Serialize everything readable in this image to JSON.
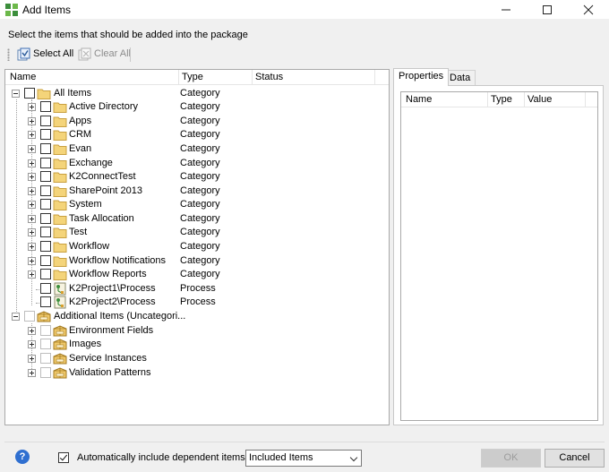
{
  "window": {
    "title": "Add Items",
    "minimize": "—",
    "maximize": "☐",
    "close": "✕"
  },
  "instruction": "Select the items that should be added into the package",
  "toolbar": {
    "select_all": "Select All",
    "clear_all": "Clear All"
  },
  "tree": {
    "columns": {
      "name": "Name",
      "type": "Type",
      "status": "Status"
    },
    "rows": [
      {
        "name": "All Items",
        "type": "Category"
      },
      {
        "name": "Active Directory",
        "type": "Category"
      },
      {
        "name": "Apps",
        "type": "Category"
      },
      {
        "name": "CRM",
        "type": "Category"
      },
      {
        "name": "Evan",
        "type": "Category"
      },
      {
        "name": "Exchange",
        "type": "Category"
      },
      {
        "name": "K2ConnectTest",
        "type": "Category"
      },
      {
        "name": "SharePoint 2013",
        "type": "Category"
      },
      {
        "name": "System",
        "type": "Category"
      },
      {
        "name": "Task Allocation",
        "type": "Category"
      },
      {
        "name": "Test",
        "type": "Category"
      },
      {
        "name": "Workflow",
        "type": "Category"
      },
      {
        "name": "Workflow Notifications",
        "type": "Category"
      },
      {
        "name": "Workflow Reports",
        "type": "Category"
      },
      {
        "name": "K2Project1\\Process",
        "type": "Process"
      },
      {
        "name": "K2Project2\\Process",
        "type": "Process"
      },
      {
        "name": "Additional Items (Uncategori...",
        "type": ""
      },
      {
        "name": "Environment Fields",
        "type": ""
      },
      {
        "name": "Images",
        "type": ""
      },
      {
        "name": "Service Instances",
        "type": ""
      },
      {
        "name": "Validation Patterns",
        "type": ""
      }
    ]
  },
  "properties": {
    "tabs": [
      "Properties",
      "Data"
    ],
    "columns": {
      "name": "Name",
      "type": "Type",
      "value": "Value"
    }
  },
  "footer": {
    "help": "?",
    "auto_include_label": "Automatically include dependent items as",
    "auto_include_checked": true,
    "combo_value": "Included Items",
    "ok": "OK",
    "cancel": "Cancel"
  },
  "icons": {
    "app": "app-icon",
    "folder": "folder-icon",
    "process": "process-icon",
    "additional": "package-icon",
    "select_all": "select-all-icon",
    "clear_all": "clear-all-icon",
    "help": "help-icon"
  }
}
